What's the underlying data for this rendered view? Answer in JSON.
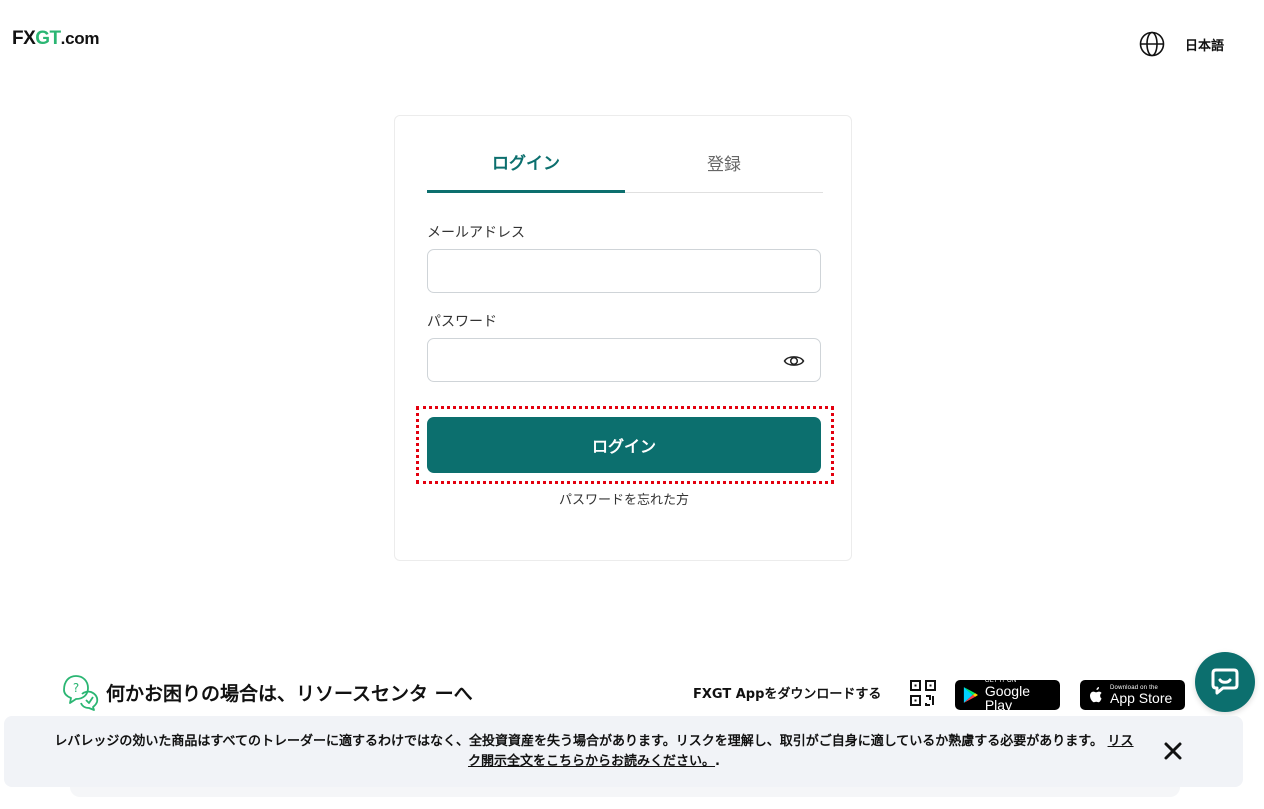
{
  "header": {
    "logo": {
      "part1": "FX",
      "part2": "GT",
      "part3": ".com"
    },
    "language": "日本語",
    "icons": {
      "language": "globe-icon"
    }
  },
  "auth": {
    "tabs": [
      {
        "label": "ログイン",
        "active": true
      },
      {
        "label": "登録",
        "active": false
      }
    ],
    "email": {
      "label": "メールアドレス",
      "value": "",
      "placeholder": ""
    },
    "password": {
      "label": "パスワード",
      "value": "",
      "placeholder": ""
    },
    "login_button": "ログイン",
    "forgot_password": "パスワードを忘れた方",
    "icons": {
      "show_password": "eye-icon"
    }
  },
  "footer": {
    "help_text": "何かお困りの場合は、リソースセンタ ーへ",
    "app_download": "FXGT Appをダウンロードする",
    "google_play": {
      "small": "GET IT ON",
      "big": "Google Play"
    },
    "app_store": {
      "small": "Download on the",
      "big": "App Store"
    },
    "icons": {
      "help": "help-bubble-icon",
      "qr": "qr-code-icon",
      "chat": "chat-icon"
    }
  },
  "risk_banner": {
    "text": "レバレッジの効いた商品はすべてのトレーダーに適するわけではなく、全投資資産を失う場合があります。リスクを理解し、取引がご自身に適しているか熟慮する必要があります。",
    "link": "リスク開示全文をこちらからお読みください。",
    "suffix": ".",
    "icons": {
      "close": "close-icon"
    }
  },
  "colors": {
    "brand": "#0c6f6e",
    "logo_accent": "#2bb673",
    "highlight": "#e3000f"
  }
}
